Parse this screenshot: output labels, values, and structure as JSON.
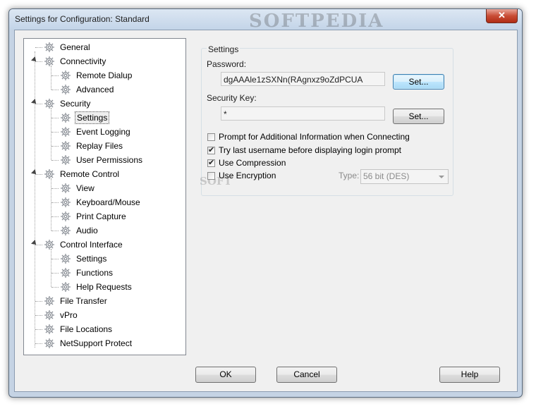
{
  "window": {
    "title": "Settings for Configuration: Standard",
    "watermark": "SOFTPEDIA",
    "close_glyph": "✕"
  },
  "tree": {
    "items": [
      {
        "label": "General",
        "level": 0
      },
      {
        "label": "Connectivity",
        "level": 0,
        "expanded": true
      },
      {
        "label": "Remote Dialup",
        "level": 1
      },
      {
        "label": "Advanced",
        "level": 1
      },
      {
        "label": "Security",
        "level": 0,
        "expanded": true
      },
      {
        "label": "Settings",
        "level": 1,
        "selected": true
      },
      {
        "label": "Event Logging",
        "level": 1
      },
      {
        "label": "Replay Files",
        "level": 1
      },
      {
        "label": "User Permissions",
        "level": 1
      },
      {
        "label": "Remote Control",
        "level": 0,
        "expanded": true
      },
      {
        "label": "View",
        "level": 1
      },
      {
        "label": "Keyboard/Mouse",
        "level": 1
      },
      {
        "label": "Print Capture",
        "level": 1
      },
      {
        "label": "Audio",
        "level": 1
      },
      {
        "label": "Control Interface",
        "level": 0,
        "expanded": true
      },
      {
        "label": "Settings",
        "level": 1
      },
      {
        "label": "Functions",
        "level": 1
      },
      {
        "label": "Help Requests",
        "level": 1
      },
      {
        "label": "File Transfer",
        "level": 0
      },
      {
        "label": "vPro",
        "level": 0
      },
      {
        "label": "File Locations",
        "level": 0
      },
      {
        "label": "NetSupport Protect",
        "level": 0
      }
    ]
  },
  "settings": {
    "group_title": "Settings",
    "password_label": "Password:",
    "password_value": "dgAAAle1zSXNn(RAgnxz9oZdPCUA",
    "password_set_button": "Set...",
    "security_key_label": "Security Key:",
    "security_key_value": "*",
    "security_key_set_button": "Set...",
    "options": [
      {
        "label": "Prompt for Additional Information when Connecting",
        "checked": false
      },
      {
        "label": "Try last username before displaying login prompt",
        "checked": true
      },
      {
        "label": "Use Compression",
        "checked": true
      },
      {
        "label": "Use Encryption",
        "checked": false
      }
    ],
    "encryption_type_label": "Type:",
    "encryption_type_value": "56 bit (DES)",
    "faint_watermark": "SOFT"
  },
  "footer": {
    "ok": "OK",
    "cancel": "Cancel",
    "help": "Help"
  }
}
